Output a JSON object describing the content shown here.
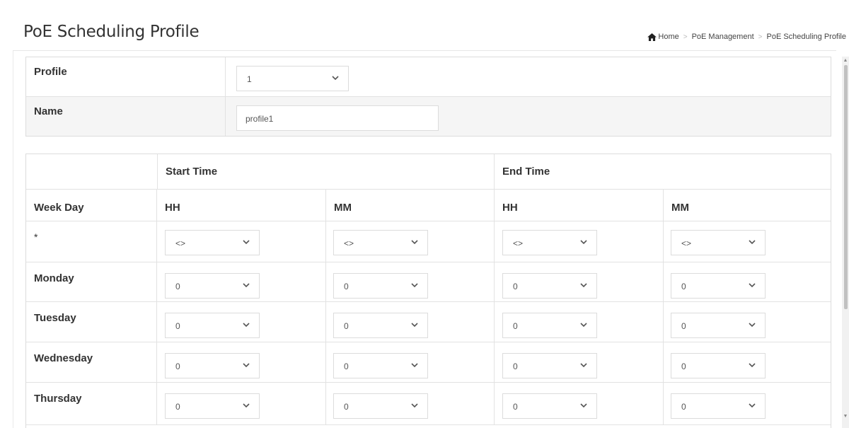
{
  "page": {
    "title": "PoE Scheduling Profile",
    "breadcrumb": [
      "Home",
      "PoE Management",
      "PoE Scheduling Profile"
    ]
  },
  "config": {
    "profile_label": "Profile",
    "profile_value": "1",
    "name_label": "Name",
    "name_value": "profile1"
  },
  "schedule": {
    "weekday_header": "Week Day",
    "start_time_header": "Start Time",
    "end_time_header": "End Time",
    "hh_label": "HH",
    "mm_label": "MM",
    "rows": [
      {
        "day": "*",
        "start_hh": "<>",
        "start_mm": "<>",
        "end_hh": "<>",
        "end_mm": "<>"
      },
      {
        "day": "Monday",
        "start_hh": "0",
        "start_mm": "0",
        "end_hh": "0",
        "end_mm": "0"
      },
      {
        "day": "Tuesday",
        "start_hh": "0",
        "start_mm": "0",
        "end_hh": "0",
        "end_mm": "0"
      },
      {
        "day": "Wednesday",
        "start_hh": "0",
        "start_mm": "0",
        "end_hh": "0",
        "end_mm": "0"
      },
      {
        "day": "Thursday",
        "start_hh": "0",
        "start_mm": "0",
        "end_hh": "0",
        "end_mm": "0"
      }
    ]
  },
  "icons": {
    "home": "home-icon",
    "dropdown": "chevron-down-icon"
  },
  "colors": {
    "border": "#dcdcdc",
    "row_alt": "#f5f5f5",
    "text": "#333333"
  }
}
